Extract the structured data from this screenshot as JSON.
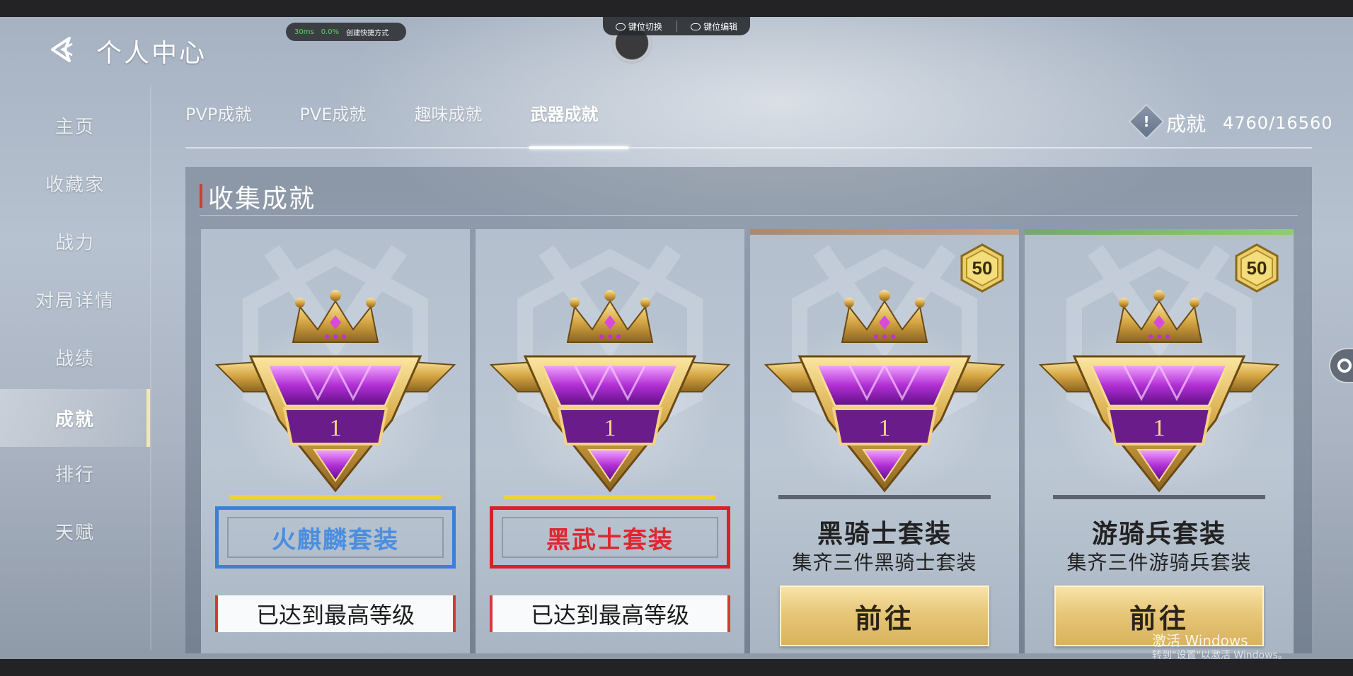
{
  "overlay": {
    "ping": "30ms",
    "loss": "0.0%",
    "shortcut": "创建快捷方式",
    "key_switch": "键位切换",
    "key_edit": "键位编辑"
  },
  "header": {
    "title": "个人中心"
  },
  "sidebar": {
    "items": [
      {
        "label": "主页"
      },
      {
        "label": "收藏家"
      },
      {
        "label": "战力"
      },
      {
        "label": "对局详情"
      },
      {
        "label": "战绩"
      },
      {
        "label": "成就"
      },
      {
        "label": "排行"
      },
      {
        "label": "天赋"
      }
    ],
    "active_index": 5
  },
  "tabs": [
    {
      "label": "PVP成就"
    },
    {
      "label": "PVE成就"
    },
    {
      "label": "趣味成就"
    },
    {
      "label": "武器成就"
    }
  ],
  "active_tab": 3,
  "score": {
    "label": "成就",
    "value": "4760/16560"
  },
  "section": {
    "title": "收集成就"
  },
  "cards": [
    {
      "name": "火麒麟套装",
      "status": "已达到最高等级",
      "level": "1",
      "name_color": "#4a8ee0",
      "border_color": "#3b7fd8"
    },
    {
      "name": "黑武士套装",
      "status": "已达到最高等级",
      "level": "1",
      "name_color": "#e0262e",
      "border_color": "#d8202a"
    },
    {
      "name": "黑骑士套装",
      "desc": "集齐三件黑骑士套装",
      "button": "前往",
      "level": "1",
      "badge": "50"
    },
    {
      "name": "游骑兵套装",
      "desc": "集齐三件游骑兵套装",
      "button": "前往",
      "level": "1",
      "badge": "50"
    }
  ],
  "watermark": {
    "title": "激活 Windows",
    "sub": "转到\"设置\"以激活 Windows。"
  },
  "colors": {
    "accent_gold": "#e6c46f",
    "yellow_line": "#f0cf3a",
    "red": "#d23b3b"
  }
}
